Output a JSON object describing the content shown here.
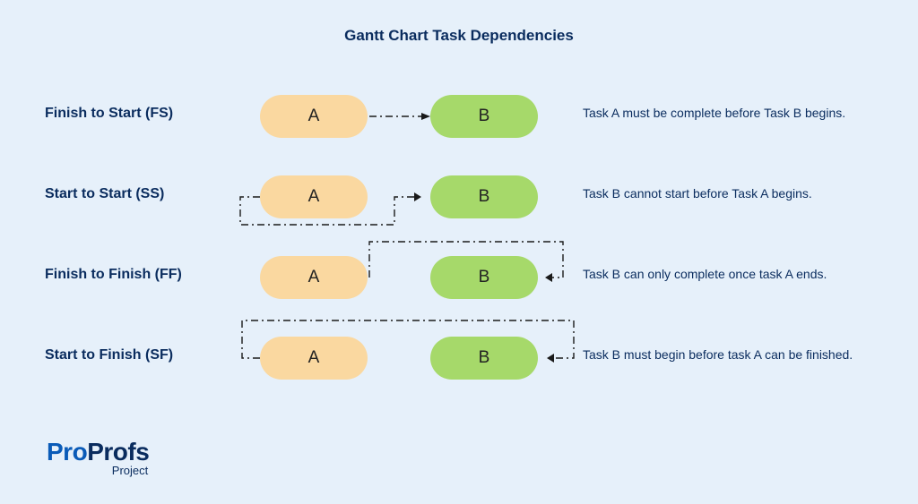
{
  "title": "Gantt Chart Task Dependencies",
  "deps": [
    {
      "label": "Finish to Start (FS)",
      "a": "A",
      "b": "B",
      "desc": "Task A must be complete before Task B begins."
    },
    {
      "label": "Start to Start (SS)",
      "a": "A",
      "b": "B",
      "desc": "Task B cannot start before Task A begins."
    },
    {
      "label": "Finish to Finish (FF)",
      "a": "A",
      "b": "B",
      "desc": "Task B can only complete once task A ends."
    },
    {
      "label": "Start to Finish (SF)",
      "a": "A",
      "b": "B",
      "desc": "Task B must begin before task A can be finished."
    }
  ],
  "logo": {
    "part1": "Pro",
    "part2": "Profs",
    "sub": "Project"
  }
}
